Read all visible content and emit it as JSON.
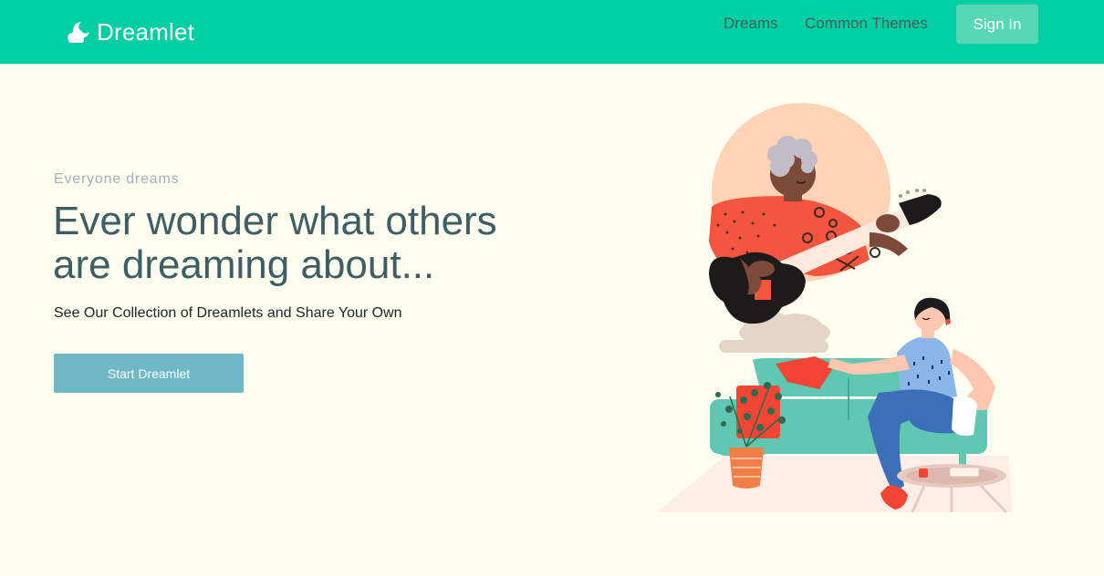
{
  "nav": {
    "brand": "Dreamlet",
    "brand_icon": "moon-cloud-icon",
    "links": [
      "Dreams",
      "Common Themes"
    ],
    "sign_in_label": "Sign In"
  },
  "hero": {
    "eyebrow": "Everyone dreams",
    "headline": "Ever wonder what others are dreaming about...",
    "subtitle": "See Our Collection of Dreamlets and Share Your Own",
    "cta_label": "Start Dreamlet"
  },
  "illustration": {
    "name": "dreaming-woman-guitar-illustration"
  },
  "colors": {
    "nav_bg": "#00cfa4",
    "page_bg": "#fdfeef",
    "sign_in_bg": "#57d8b4",
    "cta_bg": "#6fb8c6",
    "headline": "#3f5e63"
  }
}
